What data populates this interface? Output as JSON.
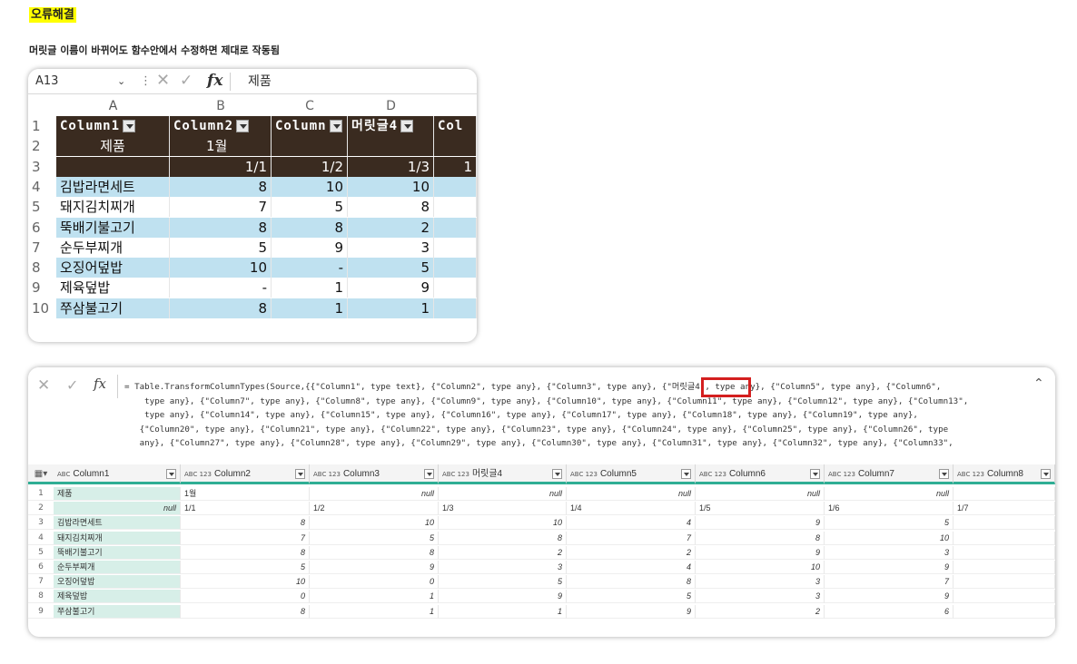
{
  "blog": {
    "title": "오류해결",
    "subtitle": "머릿글 이름이 바뀌어도 함수안에서 수정하면 제대로 작동됨"
  },
  "excel": {
    "name_box": "A13",
    "formula_value": "제품",
    "fx_label": "fx",
    "col_headers": [
      "A",
      "B",
      "C",
      "D"
    ],
    "rows": [
      {
        "num": "1",
        "cells": [
          "Column1",
          "Column2",
          "Column",
          "머릿글4",
          "Col"
        ]
      },
      {
        "num": "2",
        "cells": [
          "제품",
          "1월",
          "",
          "",
          ""
        ]
      },
      {
        "num": "3",
        "cells": [
          "",
          "1/1",
          "1/2",
          "1/3",
          "1"
        ]
      },
      {
        "num": "4",
        "cells": [
          "김밥라면세트",
          "8",
          "10",
          "10",
          ""
        ]
      },
      {
        "num": "5",
        "cells": [
          "돼지김치찌개",
          "7",
          "5",
          "8",
          ""
        ]
      },
      {
        "num": "6",
        "cells": [
          "뚝배기불고기",
          "8",
          "8",
          "2",
          ""
        ]
      },
      {
        "num": "7",
        "cells": [
          "순두부찌개",
          "5",
          "9",
          "3",
          ""
        ]
      },
      {
        "num": "8",
        "cells": [
          "오징어덮밥",
          "10",
          "-",
          "5",
          ""
        ]
      },
      {
        "num": "9",
        "cells": [
          "제육덮밥",
          "-",
          "1",
          "9",
          ""
        ]
      },
      {
        "num": "10",
        "cells": [
          "쭈삼불고기",
          "8",
          "1",
          "1",
          ""
        ]
      }
    ]
  },
  "powerquery": {
    "fx_label": "fx",
    "formula_lines": [
      "= Table.TransformColumnTypes(Source,{{\"Column1\", type text}, {\"Column2\", type any}, {\"Column3\", type any}, {\"머릿글4\", type any}, {\"Column5\", type any}, {\"Column6\",",
      "    type any}, {\"Column7\", type any}, {\"Column8\", type any}, {\"Column9\", type any}, {\"Column10\", type any}, {\"Column11\", type any}, {\"Column12\", type any}, {\"Column13\",",
      "    type any}, {\"Column14\", type any}, {\"Column15\", type any}, {\"Column16\", type any}, {\"Column17\", type any}, {\"Column18\", type any}, {\"Column19\", type any},",
      "   {\"Column20\", type any}, {\"Column21\", type any}, {\"Column22\", type any}, {\"Column23\", type any}, {\"Column24\", type any}, {\"Column25\", type any}, {\"Column26\", type",
      "   any}, {\"Column27\", type any}, {\"Column28\", type any}, {\"Column29\", type any}, {\"Column30\", type any}, {\"Column31\", type any}, {\"Column32\", type any}, {\"Column33\","
    ],
    "columns": [
      {
        "type": "ABC",
        "name": "Column1"
      },
      {
        "type": "ABC 123",
        "name": "Column2"
      },
      {
        "type": "ABC 123",
        "name": "Column3"
      },
      {
        "type": "ABC 123",
        "name": "머릿글4"
      },
      {
        "type": "ABC 123",
        "name": "Column5"
      },
      {
        "type": "ABC 123",
        "name": "Column6"
      },
      {
        "type": "ABC 123",
        "name": "Column7"
      },
      {
        "type": "ABC 123",
        "name": "Column8"
      }
    ],
    "rows": [
      {
        "num": "1",
        "cells": [
          "제품",
          "1월",
          "null",
          "null",
          "null",
          "null",
          "null",
          ""
        ]
      },
      {
        "num": "2",
        "cells": [
          "null",
          "1/1",
          "1/2",
          "1/3",
          "1/4",
          "1/5",
          "1/6",
          "1/7"
        ]
      },
      {
        "num": "3",
        "cells": [
          "김밥라면세트",
          "8",
          "10",
          "10",
          "4",
          "9",
          "5",
          ""
        ]
      },
      {
        "num": "4",
        "cells": [
          "돼지김치찌개",
          "7",
          "5",
          "8",
          "7",
          "8",
          "10",
          ""
        ]
      },
      {
        "num": "5",
        "cells": [
          "뚝배기불고기",
          "8",
          "8",
          "2",
          "2",
          "9",
          "3",
          ""
        ]
      },
      {
        "num": "6",
        "cells": [
          "순두부찌개",
          "5",
          "9",
          "3",
          "4",
          "10",
          "9",
          ""
        ]
      },
      {
        "num": "7",
        "cells": [
          "오징어덮밥",
          "10",
          "0",
          "5",
          "8",
          "3",
          "7",
          ""
        ]
      },
      {
        "num": "8",
        "cells": [
          "제육덮밥",
          "0",
          "1",
          "9",
          "5",
          "3",
          "9",
          ""
        ]
      },
      {
        "num": "9",
        "cells": [
          "쭈삼불고기",
          "8",
          "1",
          "1",
          "9",
          "2",
          "6",
          ""
        ]
      }
    ]
  }
}
